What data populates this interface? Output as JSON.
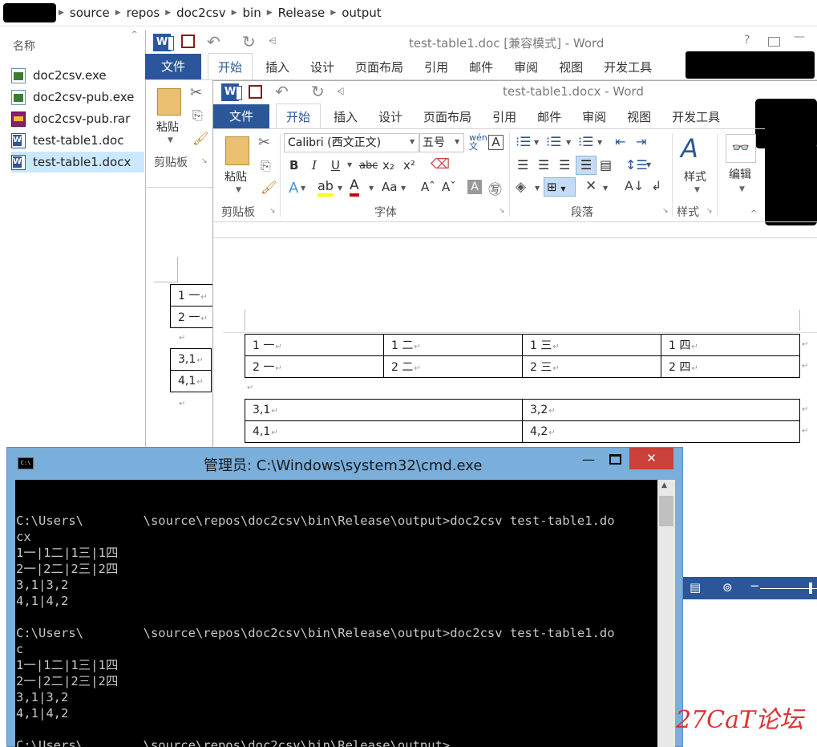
{
  "explorer": {
    "breadcrumb": [
      "source",
      "repos",
      "doc2csv",
      "bin",
      "Release",
      "output"
    ],
    "column_header": "名称",
    "files": [
      {
        "name": "doc2csv.exe",
        "icon": "exe-file-icon",
        "selected": false
      },
      {
        "name": "doc2csv-pub.exe",
        "icon": "exe-file-icon",
        "selected": false
      },
      {
        "name": "doc2csv-pub.rar",
        "icon": "rar-archive-icon",
        "selected": false
      },
      {
        "name": "test-table1.doc",
        "icon": "word-doc-icon",
        "selected": false
      },
      {
        "name": "test-table1.docx",
        "icon": "word-doc-icon",
        "selected": true
      }
    ]
  },
  "word_back": {
    "title": "test-table1.doc [兼容模式] - Word",
    "help": "?",
    "tabs": [
      "文件",
      "开始",
      "插入",
      "设计",
      "页面布局",
      "引用",
      "邮件",
      "审阅",
      "视图",
      "开发工具"
    ],
    "paste_label": "粘贴",
    "clipboard_group": "剪贴板",
    "table1": [
      [
        "1 一",
        ""
      ],
      [
        "2 一",
        ""
      ]
    ],
    "table2": [
      [
        "3,1",
        ""
      ],
      [
        "4,1",
        ""
      ]
    ]
  },
  "word_front": {
    "title": "test-table1.docx - Word",
    "tabs": [
      "文件",
      "开始",
      "插入",
      "设计",
      "页面布局",
      "引用",
      "邮件",
      "审阅",
      "视图",
      "开发工具"
    ],
    "active_tab": "开始",
    "font_name": "Calibri (西文正文)",
    "font_size": "五号",
    "groups": {
      "clipboard": "剪贴板",
      "font": "字体",
      "paragraph": "段落",
      "styles": "样式",
      "editing": "编辑"
    },
    "paste_label": "粘贴",
    "styles_label": "样式",
    "edit_label": "编辑",
    "table1": [
      [
        "1 一",
        "1 二",
        "1 三",
        "1 四"
      ],
      [
        "2 一",
        "2 二",
        "2 三",
        "2 四"
      ]
    ],
    "table2": [
      [
        "3,1",
        "3,2"
      ],
      [
        "4,1",
        "4,2"
      ]
    ]
  },
  "cmd": {
    "title": "管理员: C:\\Windows\\system32\\cmd.exe",
    "lines": [
      "",
      "C:\\Users\\        \\source\\repos\\doc2csv\\bin\\Release\\output>doc2csv test-table1.do",
      "cx",
      "1一|1二|1三|1四",
      "2一|2二|2三|2四",
      "3,1|3,2",
      "4,1|4,2",
      "",
      "C:\\Users\\        \\source\\repos\\doc2csv\\bin\\Release\\output>doc2csv test-table1.do",
      "c",
      "1一|1二|1三|1四",
      "2一|2二|2三|2四",
      "3,1|3,2",
      "4,1|4,2",
      "",
      "C:\\Users\\        \\source\\repos\\doc2csv\\bin\\Release\\output>"
    ]
  },
  "watermark": "27CaT论坛"
}
